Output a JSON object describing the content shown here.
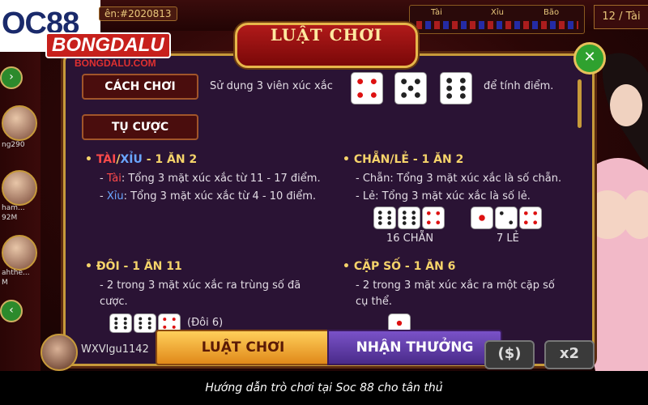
{
  "header": {
    "logo": "OC88",
    "player_id": "ên:#2020813",
    "tx_labels": [
      "Tài",
      "Xỉu",
      "Bão"
    ],
    "round": "12 / Tài"
  },
  "brand": {
    "name": "BONGDALU",
    "url": "BONGDALU.COM"
  },
  "left_players": [
    {
      "label": "ng290"
    },
    {
      "label": "ham..."
    },
    {
      "label": "92M"
    },
    {
      "label": "ahthe..."
    },
    {
      "label": "M"
    }
  ],
  "modal": {
    "title": "LUẬT CHƠI",
    "close_icon": "close-icon",
    "how_to_play_label": "CÁCH CHƠI",
    "how_to_play_pre": "Sử dụng 3 viên xúc xắc",
    "how_to_play_post": "để tính điểm.",
    "bets_label": "TỤ CƯỢC",
    "taixiu": {
      "tai": "TÀI",
      "slash": "/",
      "xiu": "XỈU",
      "odds": " - 1 ĂN 2",
      "line1_key": "Tài",
      "line1": ": Tổng 3 mặt xúc xắc từ 11 - 17 điểm.",
      "line2_key": "Xỉu",
      "line2": ": Tổng 3 mặt xúc xắc từ 4 - 10 điểm."
    },
    "chanle": {
      "heading": "CHẴN/LẺ - 1 ĂN 2",
      "line1": "- Chẵn: Tổng 3 mặt xúc xắc là số chẵn.",
      "line2": "- Lẻ: Tổng 3 mặt xúc xắc là số lẻ.",
      "example1": "16 CHẴN",
      "example2": "7 LẺ",
      "example1_dice": [
        6,
        6,
        4
      ],
      "example2_dice": [
        1,
        2,
        4
      ]
    },
    "doi": {
      "heading": "ĐÔI - 1 ĂN 11",
      "line1": "- 2 trong 3 mặt xúc xắc ra trùng số đã",
      "line2": "cược.",
      "example": "(Đôi 6)",
      "example_dice": [
        6,
        6,
        4
      ]
    },
    "capso": {
      "heading": "CẶP SỐ - 1 ĂN 6",
      "line1": "- 2 trong 3 mặt xúc xắc ra một cặp số",
      "line2": "cụ thể."
    },
    "intro_dice": [
      4,
      5,
      6
    ]
  },
  "footer": {
    "username": "WXVlgu1142",
    "tab_rules": "LUẬT CHƠI",
    "tab_rewards": "NHẬN THƯỞNG",
    "chip_dollar": "($)",
    "chip_x2": "x2"
  },
  "caption": "Hướng dẫn trò chơi tại Soc 88 cho tân thủ",
  "colors": {
    "modal_bg": "#2a1334",
    "gold": "#c79a3a",
    "tai": "#ff4a4a",
    "xiu": "#6aa6ff",
    "heading": "#f5d36a"
  }
}
